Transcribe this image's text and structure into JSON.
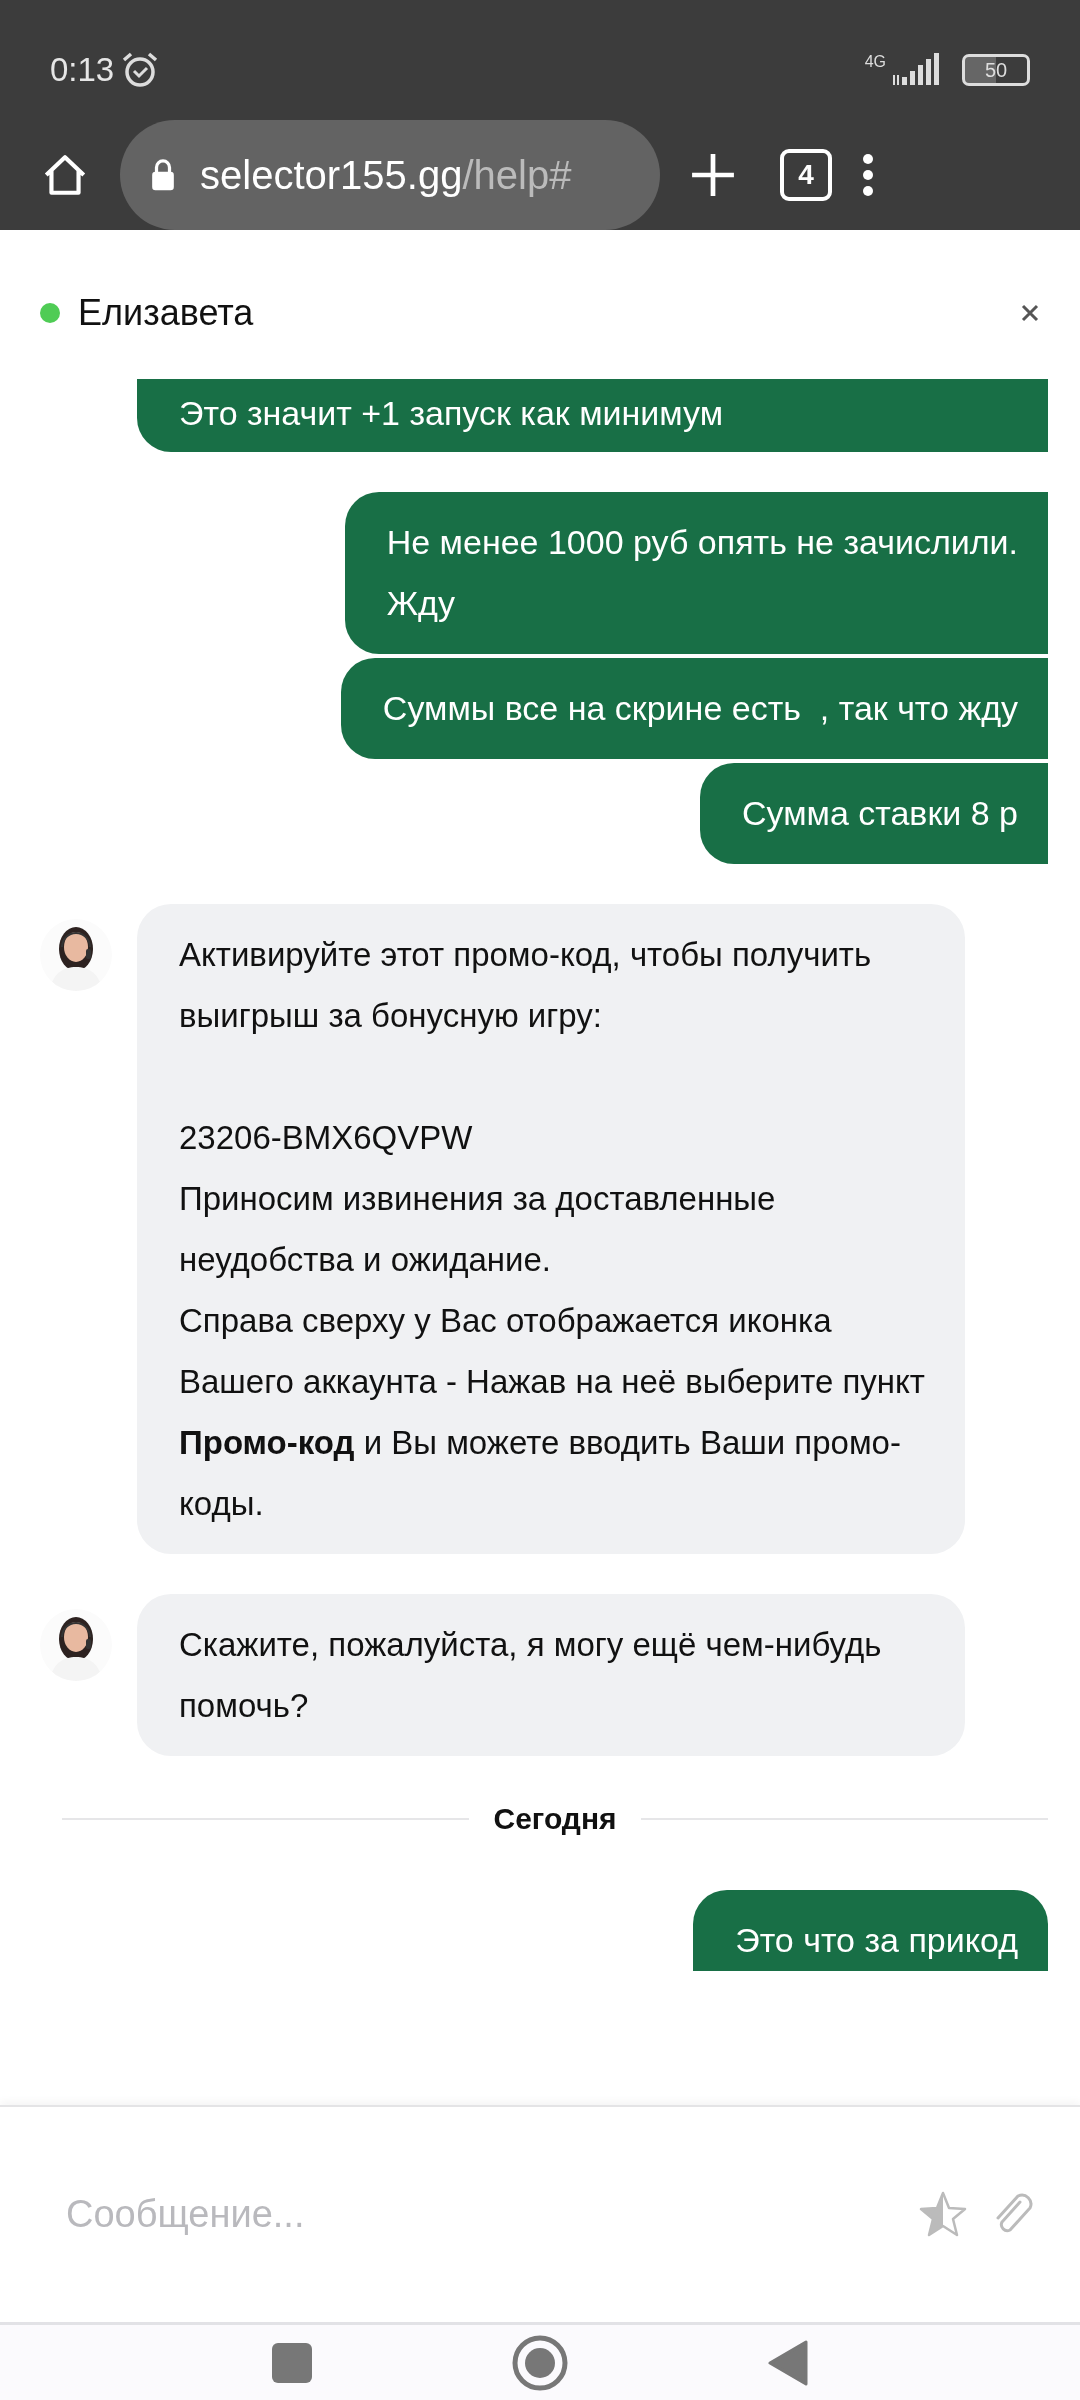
{
  "status_bar": {
    "time": "0:13",
    "network": "4G",
    "battery": "50"
  },
  "browser": {
    "url_domain": "selector155.gg",
    "url_path": "/help#",
    "tab_count": "4"
  },
  "chat": {
    "agent_name": "Елизавета",
    "online": true,
    "messages": [
      {
        "kind": "user",
        "text": "Это значит +1 запуск как минимум"
      },
      {
        "kind": "user",
        "text": "Не менее 1000 руб опять не зачислили.\nЖду"
      },
      {
        "kind": "user",
        "text": "Суммы все на скрине есть  , так что жду"
      },
      {
        "kind": "user",
        "text": "Сумма ставки 8 р"
      },
      {
        "kind": "agent",
        "text": "Активируйте этот промо-код, чтобы получить выигрыш за бонусную игру:\n\n23206-BMX6QVPW\nПриносим извинения за доставленные неудобства и ожидание.\nСправа сверху у Вас отображается иконка Вашего аккаунта - Нажав на неё выберите пункт **Промо-код** и Вы можете вводить Ваши промо-коды."
      },
      {
        "kind": "agent",
        "text": "Скажите, пожалуйста, я могу ещё чем-нибудь помочь?"
      },
      {
        "kind": "date",
        "text": "Сегодня"
      },
      {
        "kind": "user",
        "text": "Это что за прикод"
      }
    ]
  },
  "composer": {
    "placeholder": "Сообщение..."
  }
}
